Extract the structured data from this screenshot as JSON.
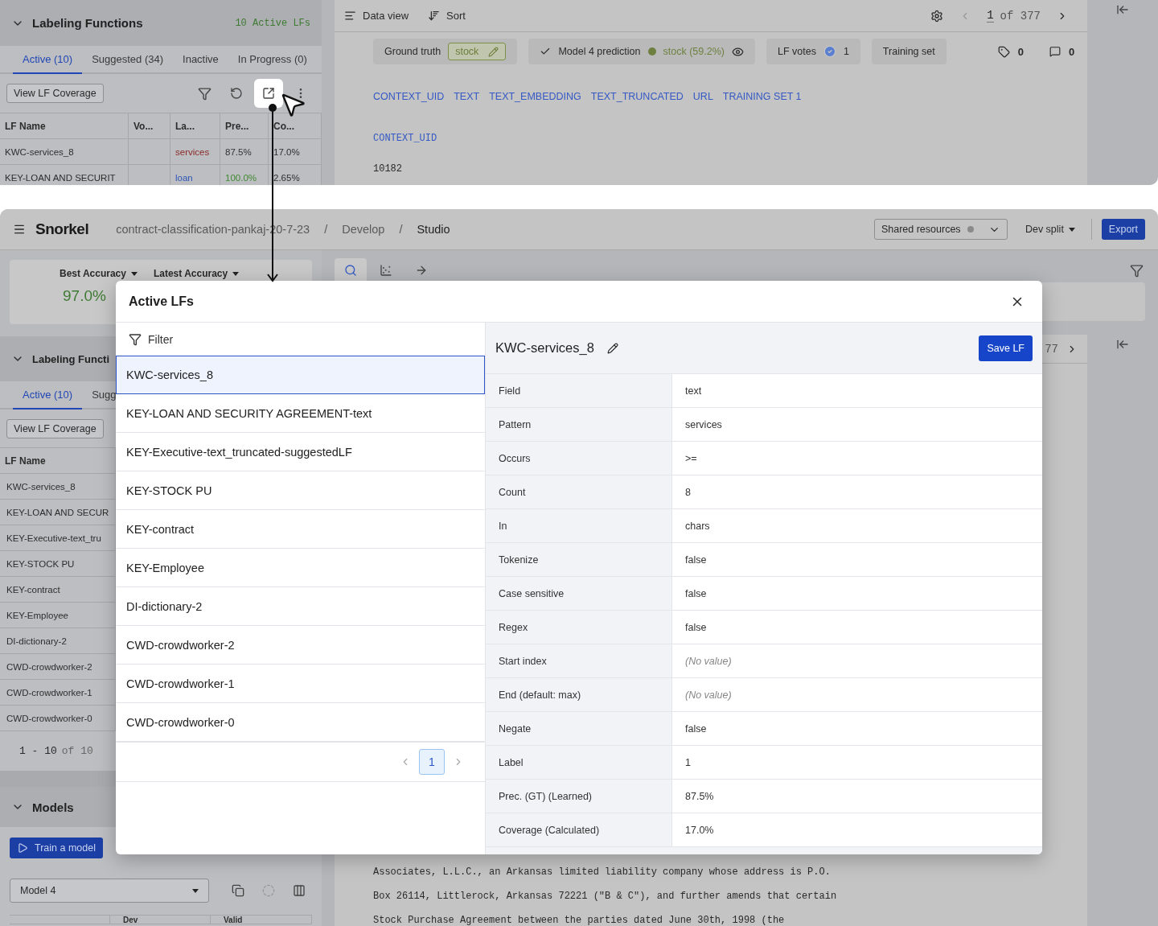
{
  "lf_panel_top": {
    "title": "Labeling Functions",
    "active_count": "10 Active LFs",
    "tabs": [
      {
        "label": "Active (10)",
        "selected": true
      },
      {
        "label": "Suggested (34)",
        "selected": false
      },
      {
        "label": "Inactive",
        "selected": false
      },
      {
        "label": "In Progress (0)",
        "selected": false
      }
    ],
    "coverage_button": "View LF Coverage",
    "columns": [
      "LF Name",
      "Vo...",
      "La...",
      "Pre...",
      "Co..."
    ],
    "rows": [
      {
        "name": "KWC-services_8",
        "label": {
          "text": "services",
          "color": "#8a2b2b"
        },
        "precision": {
          "text": "87.5%",
          "color": "#333333"
        },
        "coverage": "17.0%"
      },
      {
        "name": "KEY-LOAN AND SECURIT",
        "label": {
          "text": "loan",
          "color": "#2f55b8"
        },
        "precision": {
          "text": "100.0%",
          "color": "#3f8a33"
        },
        "coverage": "2.65%"
      }
    ]
  },
  "data_view_top": {
    "data_view": "Data view",
    "sort": "Sort",
    "page": "1",
    "page_total": "of 377",
    "ground_truth_label": "Ground truth",
    "ground_truth_value": "stock",
    "prediction_label": "Model 4 prediction",
    "prediction_value": "stock (59.2%)",
    "lf_votes_label": "LF votes",
    "lf_votes_count": "1",
    "training_set": "Training set",
    "tag_count": "0",
    "comment_count": "0",
    "columns": [
      "CONTEXT_UID",
      "TEXT",
      "TEXT_EMBEDDING",
      "TEXT_TRUNCATED",
      "URL",
      "TRAINING SET 1"
    ],
    "field_name": "CONTEXT_UID",
    "field_value": "10182"
  },
  "app": {
    "logo": "Snorkel",
    "breadcrumbs": [
      {
        "label": "contract-classification-pankaj-20-7-23",
        "current": false
      },
      {
        "label": "Develop",
        "current": false
      },
      {
        "label": "Studio",
        "current": true
      }
    ],
    "separator": "/",
    "shared_resources": "Shared resources",
    "split": "Dev split",
    "export": "Export"
  },
  "left_panel": {
    "accuracy": [
      {
        "label": "Best Accuracy",
        "value": "97.0%"
      },
      {
        "label": "Latest Accuracy"
      }
    ],
    "lf_title": "Labeling Functi",
    "tabs": [
      {
        "label": "Active (10)",
        "selected": true
      },
      {
        "label": "Sugg",
        "selected": false
      }
    ],
    "coverage_button": "View LF Coverage",
    "column": "LF Name",
    "rows": [
      "KWC-services_8",
      "KEY-LOAN AND SECUR",
      "KEY-Executive-text_tru",
      "KEY-STOCK PU",
      "KEY-contract",
      "KEY-Employee",
      "DI-dictionary-2",
      "CWD-crowdworker-2",
      "CWD-crowdworker-1",
      "CWD-crowdworker-0"
    ],
    "range": "1 - 10",
    "total": "of 10",
    "models_title": "Models",
    "train_button": "Train a model",
    "model_select": "Model 4",
    "model_columns": [
      "Dev",
      "Valid"
    ]
  },
  "right_panel": {
    "page_fragment": "77",
    "document_lines": [
      "Associates, L.L.C., an Arkansas limited liability company whose address is P.O.",
      "Box 26114, Littlerock, Arkansas 72221 (\"B & C\"), and further amends that certain",
      "Stock Purchase Agreement between the parties dated June 30th, 1998 (the"
    ]
  },
  "modal": {
    "title": "Active LFs",
    "filter": "Filter",
    "items": [
      {
        "label": "KWC-services_8",
        "selected": true
      },
      {
        "label": "KEY-LOAN AND SECURITY AGREEMENT-text",
        "selected": false
      },
      {
        "label": "KEY-Executive-text_truncated-suggestedLF",
        "selected": false
      },
      {
        "label": "KEY-STOCK PU",
        "selected": false
      },
      {
        "label": "KEY-contract",
        "selected": false
      },
      {
        "label": "KEY-Employee",
        "selected": false
      },
      {
        "label": "DI-dictionary-2",
        "selected": false
      },
      {
        "label": "CWD-crowdworker-2",
        "selected": false
      },
      {
        "label": "CWD-crowdworker-1",
        "selected": false
      },
      {
        "label": "CWD-crowdworker-0",
        "selected": false
      }
    ],
    "pages": [
      {
        "label": "1",
        "selected": true
      }
    ],
    "detail": {
      "title": "KWC-services_8",
      "save": "Save LF",
      "rows": [
        {
          "key": "Field",
          "value": "text",
          "empty": false
        },
        {
          "key": "Pattern",
          "value": "services",
          "empty": false
        },
        {
          "key": "Occurs",
          "value": ">=",
          "empty": false
        },
        {
          "key": "Count",
          "value": "8",
          "empty": false
        },
        {
          "key": "In",
          "value": "chars",
          "empty": false
        },
        {
          "key": "Tokenize",
          "value": "false",
          "empty": false
        },
        {
          "key": "Case sensitive",
          "value": "false",
          "empty": false
        },
        {
          "key": "Regex",
          "value": "false",
          "empty": false
        },
        {
          "key": "Start index",
          "value": "(No value)",
          "empty": true
        },
        {
          "key": "End (default: max)",
          "value": "(No value)",
          "empty": true
        },
        {
          "key": "Negate",
          "value": "false",
          "empty": false
        },
        {
          "key": "Label",
          "value": "1",
          "empty": false
        },
        {
          "key": "Prec. (GT) (Learned)",
          "value": "87.5%",
          "empty": false
        },
        {
          "key": "Coverage (Calculated)",
          "value": "17.0%",
          "empty": false
        }
      ]
    }
  }
}
